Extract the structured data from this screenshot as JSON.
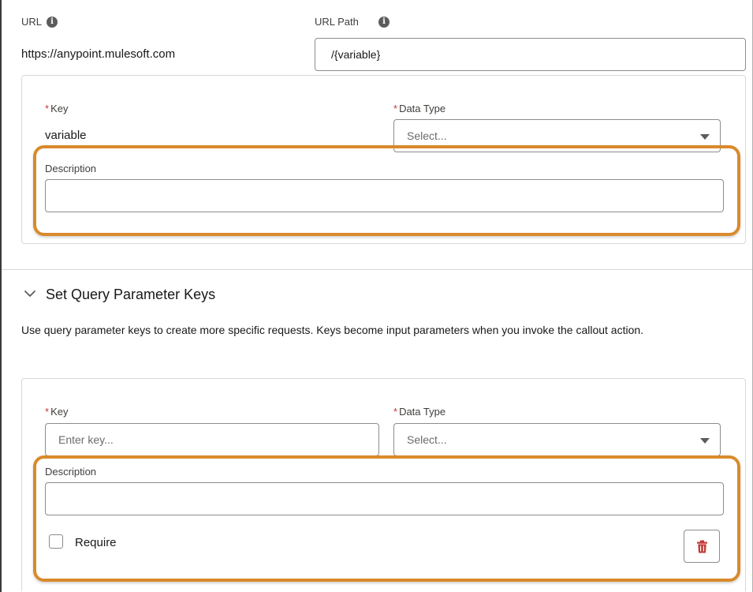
{
  "url_section": {
    "url_label": "URL",
    "url_value": "https://anypoint.mulesoft.com",
    "url_path_label": "URL Path",
    "url_path_value": "/{variable}"
  },
  "path_param": {
    "key_label": "Key",
    "key_value": "variable",
    "data_type_label": "Data Type",
    "data_type_placeholder": "Select...",
    "description_label": "Description",
    "description_value": ""
  },
  "query_section": {
    "title": "Set Query Parameter Keys",
    "help_text": "Use query parameter keys to create more specific requests. Keys become input parameters when you invoke the callout action.",
    "key_label": "Key",
    "key_placeholder": "Enter key...",
    "data_type_label": "Data Type",
    "data_type_placeholder": "Select...",
    "description_label": "Description",
    "description_value": "",
    "require_label": "Require",
    "require_checked": false
  },
  "required_marker": "*",
  "info_icon_glyph": "i",
  "icons": {
    "info": "info-icon",
    "chevron": "chevron-down-icon",
    "dropdown": "dropdown-arrow-icon",
    "delete": "trash-icon"
  },
  "colors": {
    "highlight": "#d98a2b",
    "required": "#c23934",
    "delete": "#c23934"
  }
}
